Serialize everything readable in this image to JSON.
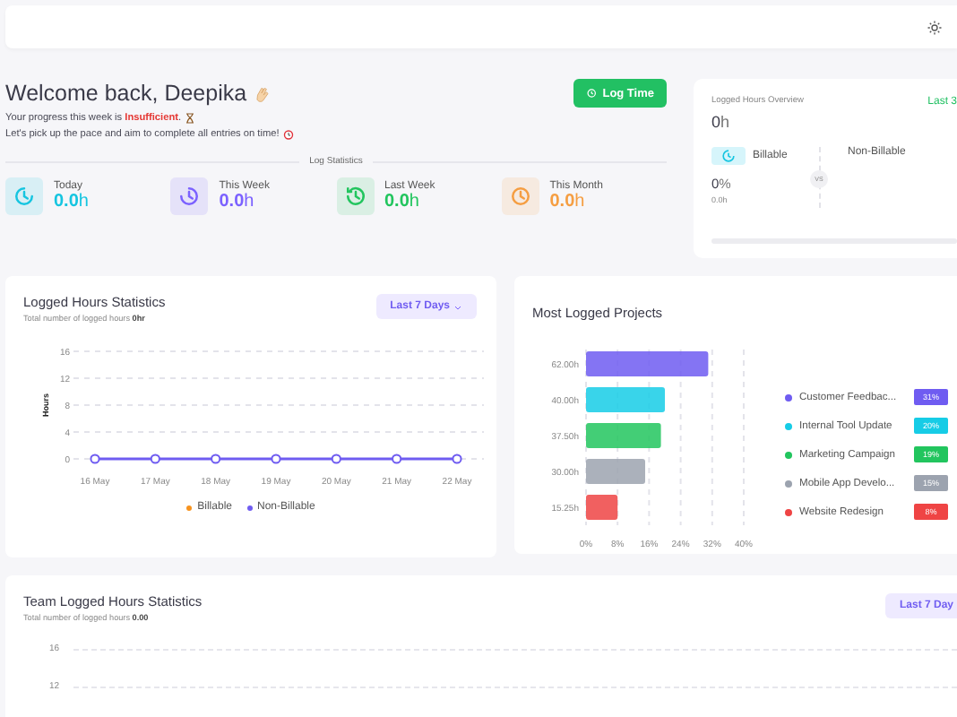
{
  "welcome": {
    "title": "Welcome back, Deepika",
    "progress_text": "Your progress this week is **Insufficient**.",
    "motivation": "Let's pick up the pace and aim to complete all entries on time!",
    "log_button": "Log Time"
  },
  "log_statistics": {
    "title": "Log Statistics",
    "items": [
      {
        "kind": "today",
        "label": "Today",
        "value": "0.0",
        "unit": "h",
        "color": "#16c5e0"
      },
      {
        "kind": "week",
        "label": "This Week",
        "value": "0.0",
        "unit": "h",
        "color": "#7b61ff"
      },
      {
        "kind": "lastweek",
        "label": "Last Week",
        "value": "0.0",
        "unit": "h",
        "color": "#22c55e"
      },
      {
        "kind": "month",
        "label": "This Month",
        "value": "0.0",
        "unit": "h",
        "color": "#f59e42"
      }
    ]
  },
  "overview": {
    "title": "Logged Hours Overview",
    "total": "0",
    "total_unit": "h",
    "period": "Last 3",
    "billable_label": "Billable",
    "billable_percent": "0",
    "percent_unit": "%",
    "billable_hours": "0.0h",
    "vs": "VS",
    "non_billable_label": "Non-Billable",
    "level": 0
  },
  "logged_hours": {
    "title": "Logged Hours Statistics",
    "subtitle": "Total number of logged hours **0hr**",
    "dropdown": "Last 7 Days",
    "chart_data": {
      "type": "line",
      "ylabel": "Hours",
      "categories": [
        "16 May",
        "17 May",
        "18 May",
        "19 May",
        "20 May",
        "21 May",
        "22 May"
      ],
      "yticks": [
        0,
        4,
        8,
        12,
        16
      ],
      "ylim": [
        0,
        16
      ],
      "grid": true,
      "legend": true,
      "series": [
        {
          "name": "Billable",
          "color": "#f7931e",
          "values": [
            null,
            null,
            null,
            null,
            null,
            null,
            null
          ]
        },
        {
          "name": "Non-Billable",
          "color": "#6f5cf1",
          "marker": true,
          "values": [
            0,
            0,
            0,
            0,
            0,
            0,
            0
          ]
        }
      ]
    }
  },
  "projects": {
    "title": "Most Logged Projects",
    "chart_data": {
      "type": "bar",
      "orientation": "horizontal",
      "categories": [
        "62.00h",
        "40.00h",
        "37.50h",
        "30.00h",
        "15.25h"
      ],
      "values": [
        31,
        20,
        19,
        15,
        8
      ],
      "xlim": [
        0,
        40
      ],
      "grid": true,
      "xticks": [
        {
          "value": 0,
          "label": "0%"
        },
        {
          "value": 8,
          "label": "8%"
        },
        {
          "value": 16,
          "label": "16%"
        },
        {
          "value": 24,
          "label": "24%"
        },
        {
          "value": 32,
          "label": "32%"
        },
        {
          "value": 40,
          "label": "40%"
        }
      ]
    },
    "legend": [
      {
        "name": "Customer Feedbac...",
        "percent": "31%",
        "color": "#6f5cf1"
      },
      {
        "name": "Internal Tool Update",
        "percent": "20%",
        "color": "#16cce6"
      },
      {
        "name": "Marketing Campaign",
        "percent": "19%",
        "color": "#22c55e"
      },
      {
        "name": "Mobile App Develo...",
        "percent": "15%",
        "color": "#9ca3af"
      },
      {
        "name": "Website Redesign",
        "percent": "8%",
        "color": "#ef4444"
      }
    ]
  },
  "team": {
    "title": "Team Logged Hours Statistics",
    "subtitle": "Total number of logged hours **0.00**",
    "dropdown": "Last 7 Day",
    "y_ticks": [
      "16",
      "12"
    ]
  }
}
